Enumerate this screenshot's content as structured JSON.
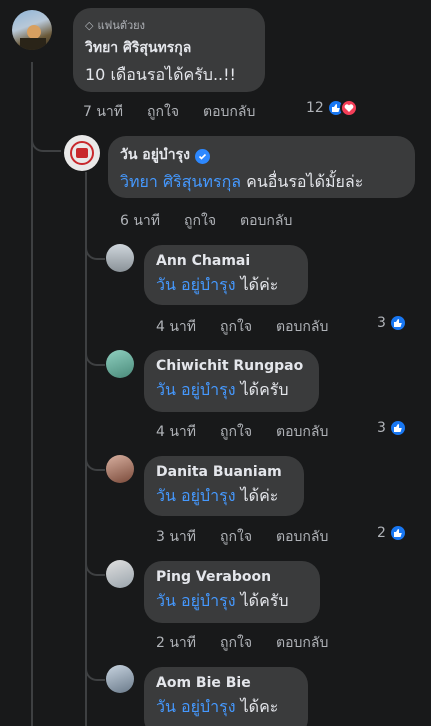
{
  "top_comment": {
    "badge": "แฟนตัวยง",
    "author": "วิทยา ศิริสุนทรกุล",
    "text": "10 เดือนรอได้ครับ..!!",
    "time": "7 นาที",
    "like_label": "ถูกใจ",
    "reply_label": "ตอบกลับ",
    "reactions": "12"
  },
  "reply_main": {
    "author": "วัน อยู่บำรุง",
    "mention": "วิทยา ศิริสุนทรกุล",
    "text": " คนอื่นรอได้มั้ยล่ะ",
    "time": "6 นาที",
    "like_label": "ถูกใจ",
    "reply_label": "ตอบกลับ"
  },
  "replies": [
    {
      "author": "Ann Chamai",
      "mention": "วัน อยู่บำรุง",
      "text": " ได้ค่ะ",
      "time": "4 นาที",
      "like_label": "ถูกใจ",
      "reply_label": "ตอบกลับ",
      "reactions": "3"
    },
    {
      "author": "Chiwichit Rungpao",
      "mention": "วัน อยู่บำรุง",
      "text": " ได้ครับ",
      "time": "4 นาที",
      "like_label": "ถูกใจ",
      "reply_label": "ตอบกลับ",
      "reactions": "3"
    },
    {
      "author": "Danita Buaniam",
      "mention": "วัน อยู่บำรุง",
      "text": " ได้ค่ะ",
      "time": "3 นาที",
      "like_label": "ถูกใจ",
      "reply_label": "ตอบกลับ",
      "reactions": "2"
    },
    {
      "author": "Ping Veraboon",
      "mention": "วัน อยู่บำรุง",
      "text": " ได้ครับ",
      "time": "2 นาที",
      "like_label": "ถูกใจ",
      "reply_label": "ตอบกลับ",
      "reactions": ""
    },
    {
      "author": "Aom Bie Bie",
      "mention": "วัน อยู่บำรุง",
      "text": " ได้คะ",
      "time": "",
      "like_label": "",
      "reply_label": "",
      "reactions": ""
    }
  ],
  "colors": {
    "background": "#18191a",
    "bubble": "#3a3b3c",
    "mention": "#4599ff",
    "like": "#1877f2",
    "love": "#f33e58"
  }
}
